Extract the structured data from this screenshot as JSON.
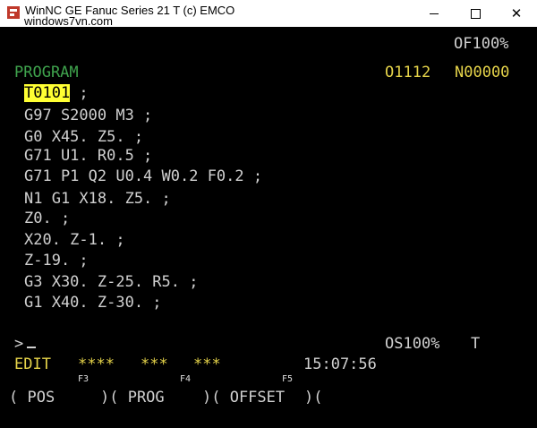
{
  "window": {
    "title": "WinNC GE Fanuc Series 21 T (c) EMCO",
    "watermark": "windows7vn.com",
    "minimize_icon": "minimize-icon",
    "maximize_icon": "maximize-icon",
    "close_glyph": "✕"
  },
  "status": {
    "override": "OF100%",
    "mode_label": "PROGRAM",
    "program_number": "O1112",
    "sequence_number": "N00000"
  },
  "program": {
    "highlighted_word": "T0101",
    "lines": [
      "T0101 ;",
      "G97 S2000 M3 ;",
      "G0 X45. Z5. ;",
      "G71 U1. R0.5 ;",
      "G71 P1 Q2 U0.4 W0.2 F0.2 ;",
      "N1 G1 X18. Z5. ;",
      "Z0. ;",
      "X20. Z-1. ;",
      "Z-19. ;",
      "G3 X30. Z-25. R5. ;",
      "G1 X40. Z-30. ;"
    ]
  },
  "input": {
    "prompt": ">",
    "spindle_override": "OS100%",
    "channel": "T"
  },
  "footer": {
    "mode": "EDIT",
    "stars": [
      "****",
      "***",
      "***"
    ],
    "time": "15:07:56",
    "fkeys": [
      "F3",
      "F4",
      "F5"
    ],
    "softkeys": [
      "( POS",
      ")( PROG",
      ")( OFFSET",
      ")("
    ]
  }
}
